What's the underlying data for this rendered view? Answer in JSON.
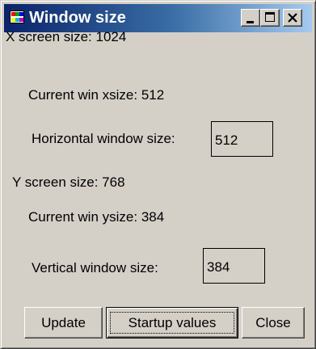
{
  "window": {
    "title": "Window size",
    "icon": "app-icon",
    "caption_buttons": [
      "minimize-icon",
      "maximize-icon",
      "close-icon"
    ]
  },
  "x_section": {
    "screen_size_label": "X screen size: 1024",
    "current_size_label": "Current win xsize: 512",
    "input_label": "Horizontal window size:",
    "input_value": "512"
  },
  "y_section": {
    "screen_size_label": "Y screen size: 768",
    "current_size_label": "Current win ysize: 384",
    "input_label": "Vertical window size:",
    "input_value": "384"
  },
  "buttons": {
    "update": "Update",
    "startup": "Startup values",
    "close": "Close"
  },
  "colors": {
    "title_bar_start": "#0a246a",
    "title_bar_end": "#a6caf0",
    "face": "#d4d0c8"
  }
}
